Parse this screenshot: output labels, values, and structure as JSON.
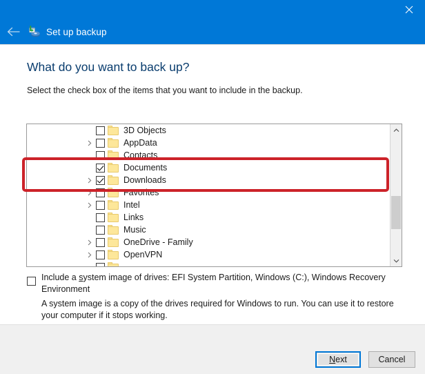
{
  "titlebar": {
    "title": "Set up backup",
    "back_icon": "back-arrow-icon",
    "close_icon": "close-icon",
    "app_icon": "backup-icon",
    "background_color": "#0078d7"
  },
  "content": {
    "heading": "What do you want to back up?",
    "subheading": "Select the check box of the items that you want to include in the backup.",
    "heading_color": "#0a3d6e"
  },
  "tree": {
    "items": [
      {
        "label": "3D Objects",
        "checked": false,
        "expandable": false
      },
      {
        "label": "AppData",
        "checked": false,
        "expandable": true
      },
      {
        "label": "Contacts",
        "checked": false,
        "expandable": false
      },
      {
        "label": "Documents",
        "checked": true,
        "expandable": false
      },
      {
        "label": "Downloads",
        "checked": true,
        "expandable": true
      },
      {
        "label": "Favorites",
        "checked": false,
        "expandable": true
      },
      {
        "label": "Intel",
        "checked": false,
        "expandable": true
      },
      {
        "label": "Links",
        "checked": false,
        "expandable": false
      },
      {
        "label": "Music",
        "checked": false,
        "expandable": false
      },
      {
        "label": "OneDrive - Family",
        "checked": false,
        "expandable": true
      },
      {
        "label": "OpenVPN",
        "checked": false,
        "expandable": true
      },
      {
        "label": "",
        "checked": false,
        "expandable": false
      }
    ],
    "scrollbar": {
      "up_icon": "chevron-up-icon",
      "down_icon": "chevron-down-icon"
    }
  },
  "system_image": {
    "checked": false,
    "label_before": "Include a ",
    "label_accel": "s",
    "label_after": "ystem image of drives: EFI System Partition, Windows (C:), Windows Recovery Environment",
    "description": "A system image is a copy of the drives required for Windows to run. You can use it to restore your computer if it stops working."
  },
  "footer": {
    "next_accel": "N",
    "next_rest": "ext",
    "cancel_label": "Cancel",
    "focus_color": "#0078d7"
  },
  "annotation": {
    "color": "#cc2229",
    "description": "highlight-rectangle"
  }
}
